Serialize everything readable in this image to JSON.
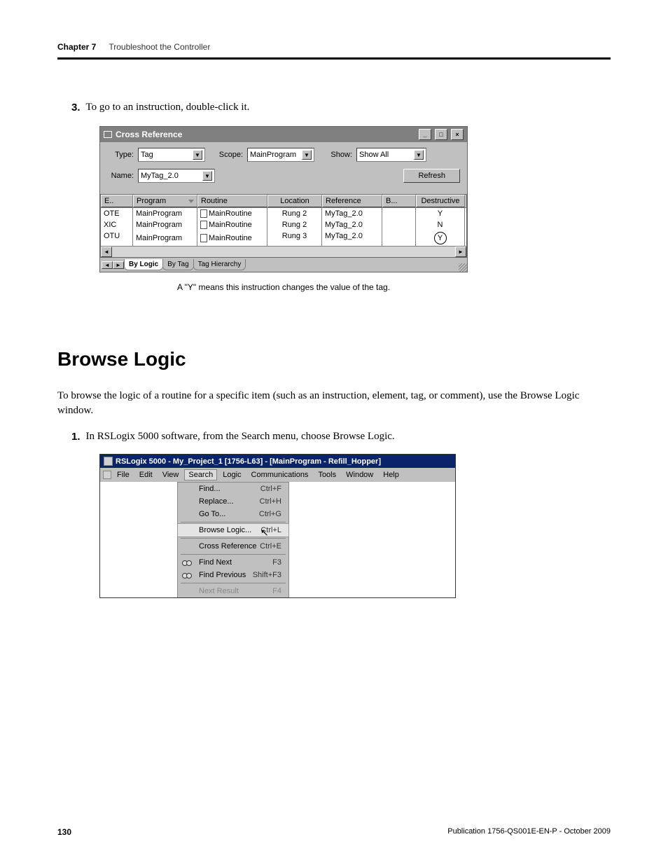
{
  "header": {
    "chapter": "Chapter 7",
    "title": "Troubleshoot the Controller"
  },
  "step3": {
    "num": "3.",
    "text": "To go to an instruction, double-click it."
  },
  "crossref": {
    "title": "Cross Reference",
    "fields": {
      "type_label": "Type:",
      "type_value": "Tag",
      "scope_label": "Scope:",
      "scope_value": "MainProgram",
      "show_label": "Show:",
      "show_value": "Show All",
      "name_label": "Name:",
      "name_value": "MyTag_2.0",
      "refresh": "Refresh"
    },
    "columns": [
      "E..",
      "Program",
      "Routine",
      "Location",
      "Reference",
      "B...",
      "Destructive"
    ],
    "rows": [
      {
        "e": "OTE",
        "program": "MainProgram",
        "routine": "MainRoutine",
        "location": "Rung 2",
        "reference": "MyTag_2.0",
        "b": "",
        "destructive": "Y",
        "circled": false
      },
      {
        "e": "XIC",
        "program": "MainProgram",
        "routine": "MainRoutine",
        "location": "Rung 2",
        "reference": "MyTag_2.0",
        "b": "",
        "destructive": "N",
        "circled": false
      },
      {
        "e": "OTU",
        "program": "MainProgram",
        "routine": "MainRoutine",
        "location": "Rung 3",
        "reference": "MyTag_2.0",
        "b": "",
        "destructive": "Y",
        "circled": true
      }
    ],
    "tabs": [
      "By Logic",
      "By Tag",
      "Tag Hierarchy"
    ]
  },
  "caption": "A \"Y\" means this instruction changes the value of the tag.",
  "section": {
    "title": "Browse Logic"
  },
  "body": "To browse the logic of a routine for a specific item (such as an instruction, element, tag, or comment), use the Browse Logic window.",
  "step1b": {
    "num": "1.",
    "text": "In RSLogix 5000 software, from the Search menu, choose Browse Logic."
  },
  "rslogix": {
    "title": "RSLogix 5000 - My_Project_1 [1756-L63] - [MainProgram - Refill_Hopper]",
    "menus": [
      "File",
      "Edit",
      "View",
      "Search",
      "Logic",
      "Communications",
      "Tools",
      "Window",
      "Help"
    ],
    "items": [
      {
        "label": "Find...",
        "sc": "Ctrl+F"
      },
      {
        "label": "Replace...",
        "sc": "Ctrl+H"
      },
      {
        "label": "Go To...",
        "sc": "Ctrl+G"
      },
      {
        "sep": true
      },
      {
        "label": "Browse Logic...",
        "sc": "Ctrl+L",
        "hl": true
      },
      {
        "sep": true
      },
      {
        "label": "Cross Reference",
        "sc": "Ctrl+E"
      },
      {
        "sep": true
      },
      {
        "label": "Find Next",
        "sc": "F3",
        "icon": "binoc"
      },
      {
        "label": "Find Previous",
        "sc": "Shift+F3",
        "icon": "binoc"
      },
      {
        "sep": true
      },
      {
        "label": "Next Result",
        "sc": "F4",
        "disabled": true
      }
    ]
  },
  "footer": {
    "page": "130",
    "pub": "Publication 1756-QS001E-EN-P - October 2009"
  }
}
